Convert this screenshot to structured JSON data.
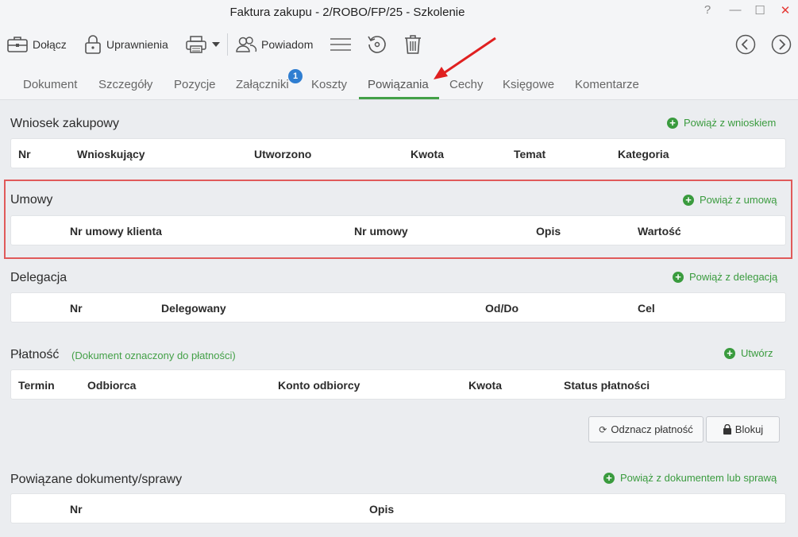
{
  "window": {
    "title": "Faktura zakupu - 2/ROBO/FP/25 - Szkolenie",
    "help": "?",
    "minimize": "—",
    "maximize": "☐",
    "close": "✕"
  },
  "toolbar": {
    "attach_label": "Dołącz",
    "permissions_label": "Uprawnienia",
    "notify_label": "Powiadom"
  },
  "tabs": [
    {
      "label": "Dokument"
    },
    {
      "label": "Szczegóły"
    },
    {
      "label": "Pozycje"
    },
    {
      "label": "Załączniki",
      "badge": "1"
    },
    {
      "label": "Koszty"
    },
    {
      "label": "Powiązania"
    },
    {
      "label": "Cechy"
    },
    {
      "label": "Księgowe"
    },
    {
      "label": "Komentarze"
    }
  ],
  "active_tab": "Powiązania",
  "sections": {
    "request": {
      "title": "Wniosek zakupowy",
      "action": "Powiąż z wnioskiem",
      "columns": [
        "Nr",
        "Wnioskujący",
        "Utworzono",
        "Kwota",
        "Temat",
        "Kategoria"
      ]
    },
    "contracts": {
      "title": "Umowy",
      "action": "Powiąż z umową",
      "columns": [
        "Nr umowy klienta",
        "Nr umowy",
        "Opis",
        "Wartość"
      ]
    },
    "delegation": {
      "title": "Delegacja",
      "action": "Powiąż z delegacją",
      "columns": [
        "Nr",
        "Delegowany",
        "Od/Do",
        "Cel"
      ]
    },
    "payment": {
      "title": "Płatność",
      "note": "(Dokument oznaczony do płatności)",
      "action": "Utwórz",
      "columns": [
        "Termin",
        "Odbiorca",
        "Konto odbiorcy",
        "Kwota",
        "Status płatności"
      ],
      "unmark_button": "Odznacz płatność",
      "block_button": "Blokuj"
    },
    "related": {
      "title": "Powiązane dokumenty/sprawy",
      "action": "Powiąż z dokumentem lub sprawą",
      "columns": [
        "Nr",
        "Opis"
      ]
    }
  },
  "colors": {
    "accent_green": "#43a047",
    "highlight_red": "#e05a5a",
    "arrow_red": "#e02020",
    "badge_blue": "#2f7ed1"
  }
}
